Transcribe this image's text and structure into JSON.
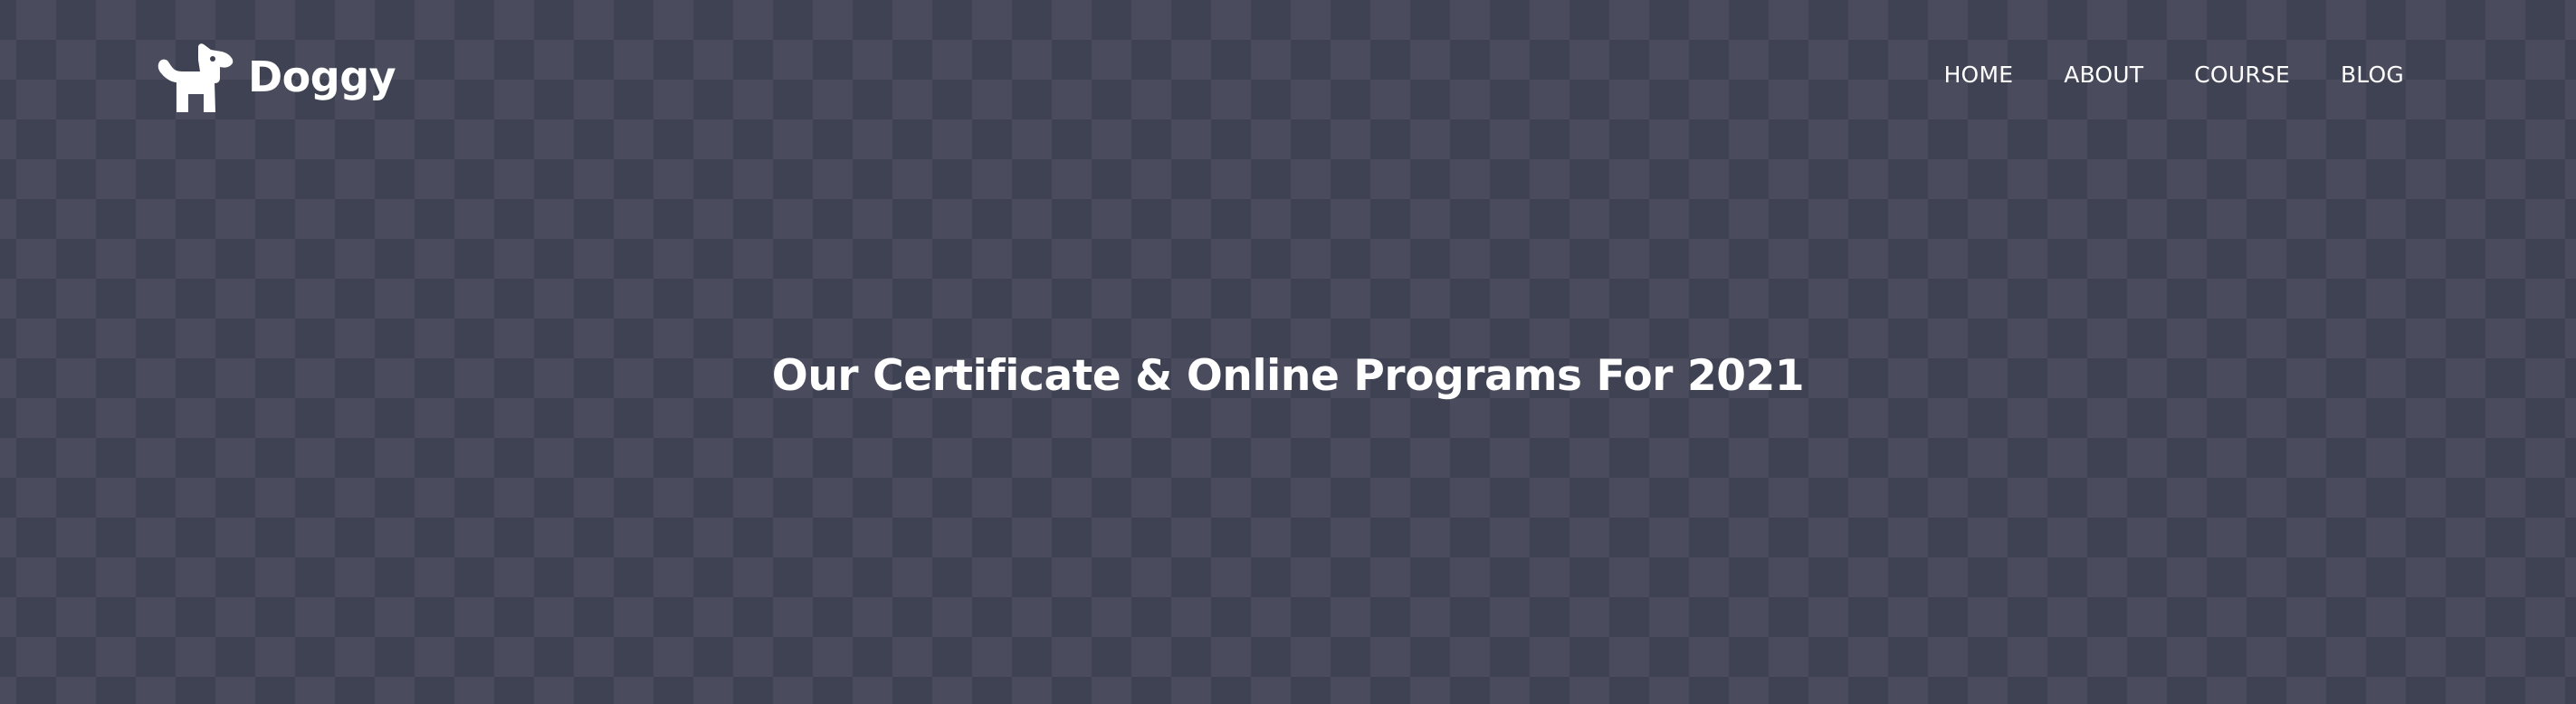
{
  "brand": {
    "name": "Doggy",
    "icon": "dog-icon"
  },
  "nav": {
    "items": [
      {
        "label": "HOME"
      },
      {
        "label": "ABOUT"
      },
      {
        "label": "COURSE"
      },
      {
        "label": "BLOG"
      }
    ]
  },
  "hero": {
    "headline": "Our Certificate & Online Programs For 2021",
    "background": {
      "pattern": "checkerboard",
      "light_color": "#4b4e5f",
      "dark_color": "#3e4152"
    }
  },
  "colors": {
    "text": "#ffffff"
  }
}
